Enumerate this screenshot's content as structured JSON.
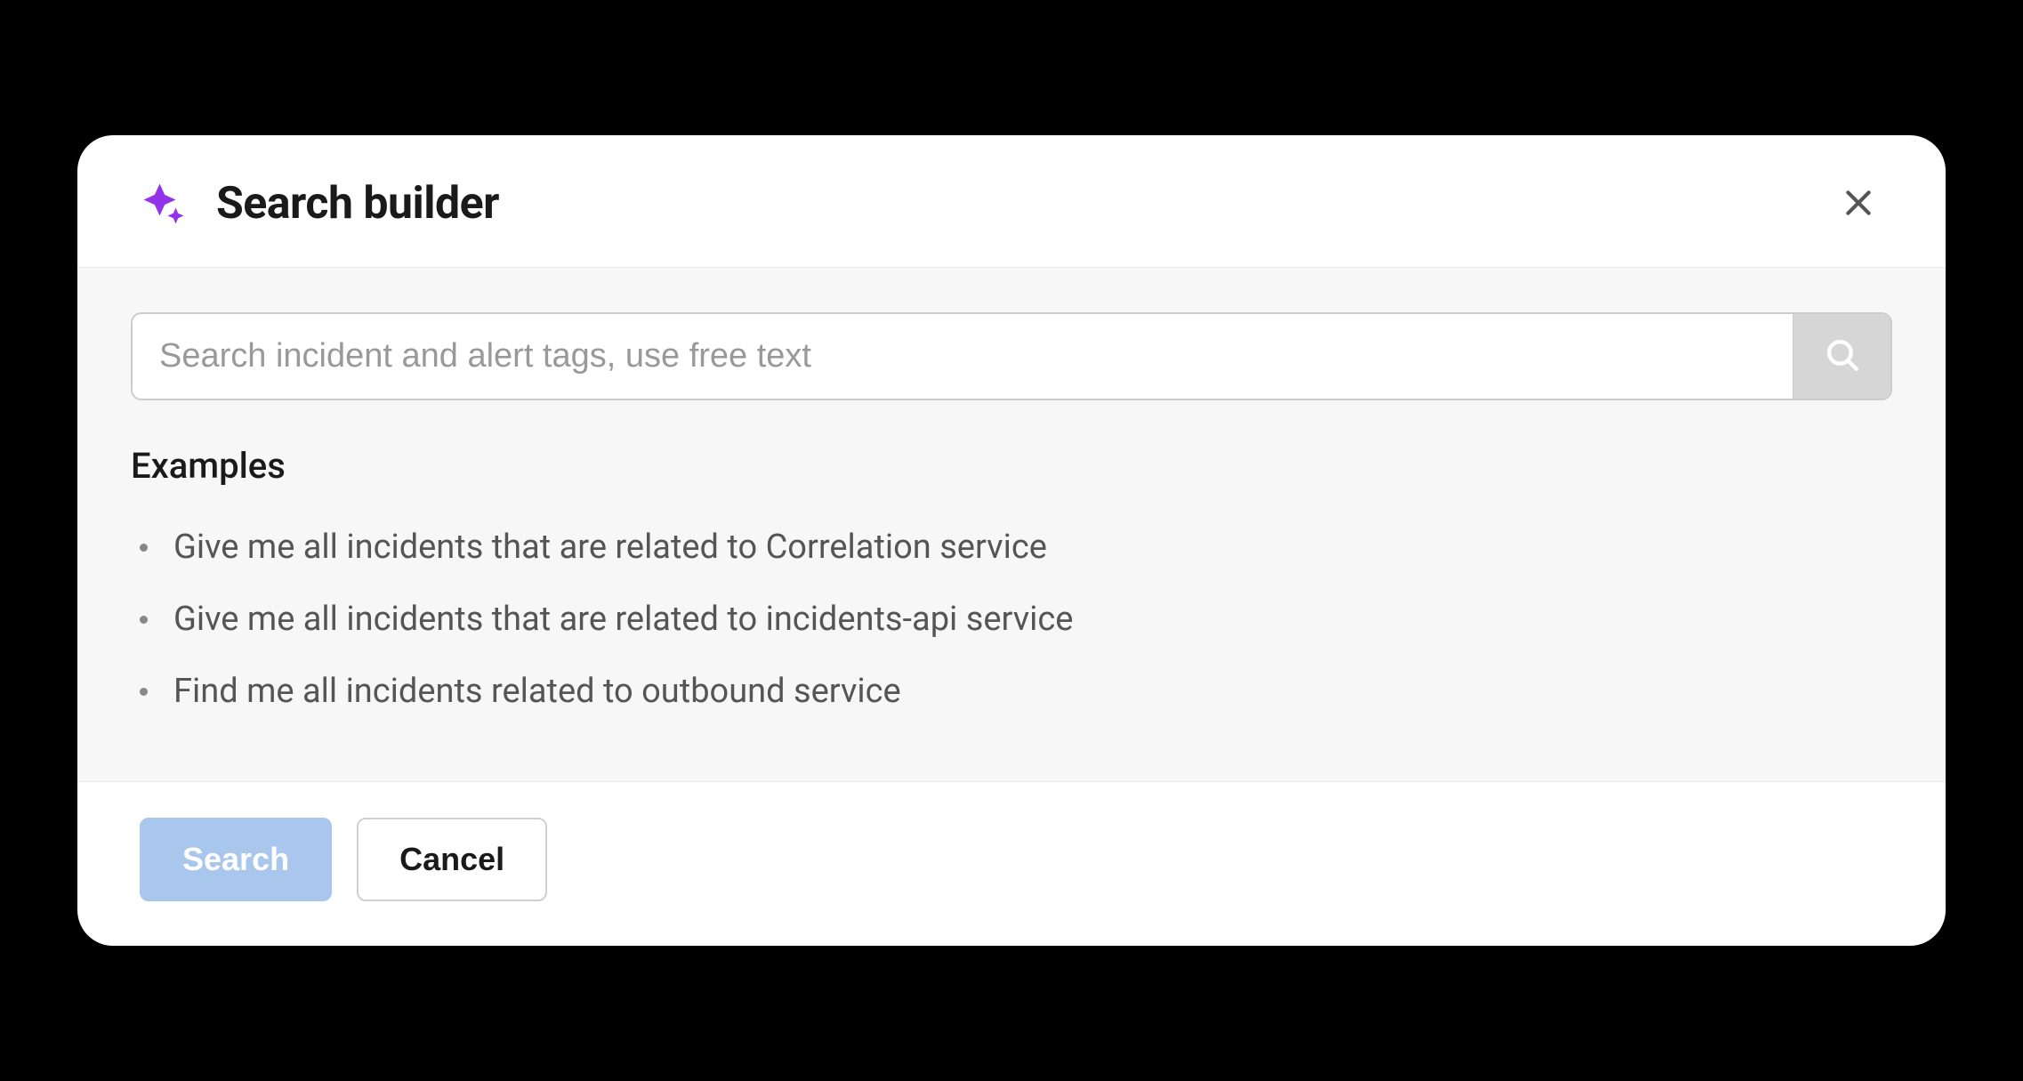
{
  "header": {
    "title": "Search builder"
  },
  "search": {
    "placeholder": "Search incident and alert tags, use free text",
    "value": ""
  },
  "examples": {
    "heading": "Examples",
    "items": [
      "Give me all incidents that are related to Correlation service",
      "Give me all incidents that are related to incidents-api service",
      "Find me all incidents related to outbound service"
    ]
  },
  "footer": {
    "search_label": "Search",
    "cancel_label": "Cancel"
  }
}
